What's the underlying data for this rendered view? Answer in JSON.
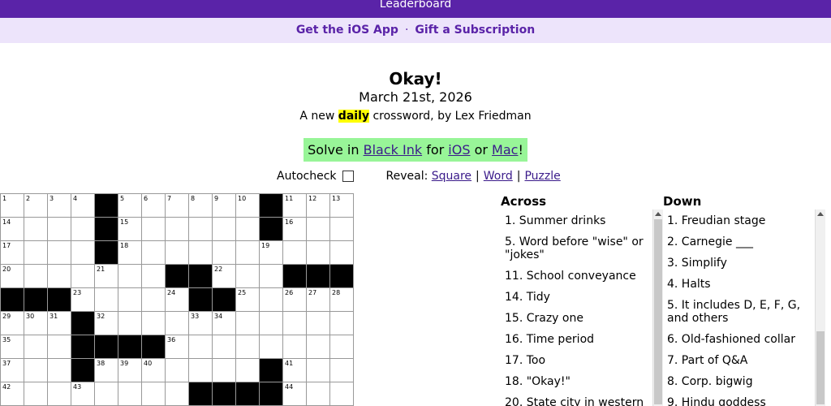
{
  "topbar": {
    "label": "Leaderboard"
  },
  "subbar": {
    "ios_link": "Get the iOS App",
    "sep": "·",
    "gift_link": "Gift a Subscription"
  },
  "header": {
    "title": "Okay!",
    "date": "March 21st, 2026",
    "byline_pre": "A new",
    "byline_hl": "daily",
    "byline_post": "crossword, by Lex Friedman"
  },
  "solve": {
    "pre": "Solve in",
    "app": "Black Ink",
    "mid1": "for",
    "ios": "iOS",
    "mid2": "or",
    "mac": "Mac",
    "end": "!"
  },
  "controls": {
    "autocheck": "Autocheck",
    "reveal": "Reveal:",
    "square": "Square",
    "word": "Word",
    "puzzle": "Puzzle"
  },
  "grid": {
    "cols": 15,
    "rows": [
      {
        "numbers": [
          1,
          2,
          3,
          4,
          null,
          5,
          6,
          7,
          8,
          9,
          10,
          null,
          11,
          12,
          13
        ],
        "black": [
          4,
          11
        ]
      },
      {
        "numbers": [
          14,
          null,
          null,
          null,
          null,
          15,
          null,
          null,
          null,
          null,
          null,
          null,
          16,
          null,
          null
        ],
        "black": [
          4,
          11
        ]
      },
      {
        "numbers": [
          17,
          null,
          null,
          null,
          null,
          18,
          null,
          null,
          null,
          null,
          null,
          19,
          null,
          null,
          null
        ],
        "black": [
          4
        ]
      },
      {
        "numbers": [
          20,
          null,
          null,
          null,
          21,
          null,
          null,
          null,
          null,
          22,
          null,
          null,
          null,
          null,
          null
        ],
        "black": [
          7,
          8,
          12,
          13,
          14
        ]
      },
      {
        "numbers": [
          null,
          null,
          null,
          23,
          null,
          null,
          null,
          24,
          null,
          null,
          25,
          null,
          26,
          27,
          28
        ],
        "black": [
          0,
          1,
          2,
          8,
          9
        ]
      },
      {
        "numbers": [
          29,
          30,
          31,
          null,
          32,
          null,
          null,
          null,
          33,
          34,
          null,
          null,
          null,
          null,
          null
        ],
        "black": [
          3
        ]
      },
      {
        "numbers": [
          35,
          null,
          null,
          null,
          null,
          null,
          null,
          36,
          null,
          null,
          null,
          null,
          null,
          null,
          null
        ],
        "black": [
          3,
          4,
          5,
          6
        ]
      },
      {
        "numbers": [
          37,
          null,
          null,
          null,
          38,
          39,
          40,
          null,
          null,
          null,
          null,
          null,
          41,
          null,
          null
        ],
        "black": [
          3,
          11
        ]
      },
      {
        "numbers": [
          42,
          null,
          null,
          43,
          null,
          null,
          null,
          null,
          null,
          null,
          null,
          null,
          44,
          null,
          null
        ],
        "black": [
          8,
          9,
          10,
          11
        ]
      }
    ]
  },
  "across": {
    "heading": "Across",
    "clues": [
      "1. Summer drinks",
      "5. Word before \"wise\" or \"jokes\"",
      "11. School conveyance",
      "14. Tidy",
      "15. Crazy one",
      "16. Time period",
      "17. Too",
      "18. \"Okay!\"",
      "20. State city in western"
    ]
  },
  "down": {
    "heading": "Down",
    "clues": [
      "1. Freudian stage",
      "2. Carnegie ___",
      "3. Simplify",
      "4. Halts",
      "5. It includes D, E, F, G, and others",
      "6. Old-fashioned collar",
      "7. Part of Q&A",
      "8. Corp. bigwig",
      "9. Hindu goddess"
    ]
  }
}
